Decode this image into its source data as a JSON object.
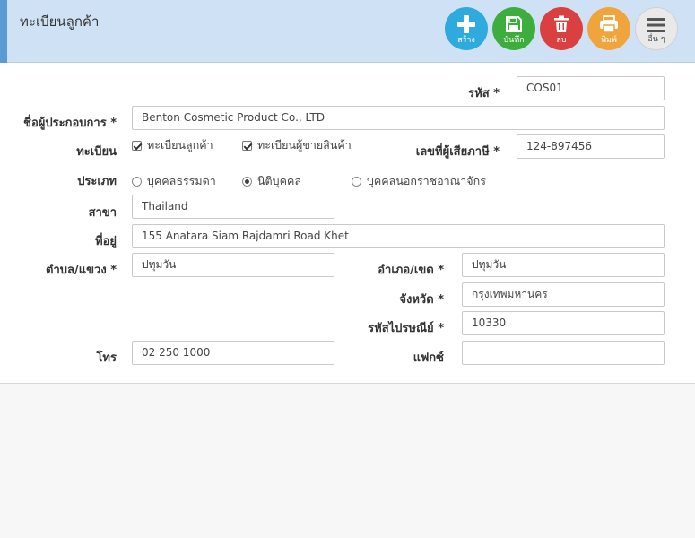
{
  "header": {
    "title": "ทะเบียนลูกค้า",
    "buttons": [
      {
        "label": "สร้าง",
        "icon": "plus-icon",
        "color": "#2eaade"
      },
      {
        "label": "บันทึก",
        "icon": "save-icon",
        "color": "#3dae3d"
      },
      {
        "label": "ลบ",
        "icon": "trash-icon",
        "color": "#da4040"
      },
      {
        "label": "พิมพ์",
        "icon": "print-icon",
        "color": "#f0a43c"
      },
      {
        "label": "อื่น ๆ",
        "icon": "menu-icon",
        "color": "#e9e9e9"
      }
    ]
  },
  "form": {
    "code": {
      "label": "รหัส *",
      "value": "COS01"
    },
    "name": {
      "label": "ชื่อผู้ประกอบการ *",
      "value": "Benton Cosmetic Product Co., LTD"
    },
    "registration": {
      "label": "ทะเบียน",
      "options": [
        {
          "label": "ทะเบียนลูกค้า",
          "checked": true
        },
        {
          "label": "ทะเบียนผู้ขายสินค้า",
          "checked": true
        }
      ]
    },
    "tax_id": {
      "label": "เลขที่ผู้เสียภาษี *",
      "value": "124-897456"
    },
    "type": {
      "label": "ประเภท",
      "options": [
        {
          "label": "บุคคลธรรมดา",
          "selected": false
        },
        {
          "label": "นิติบุคคล",
          "selected": true
        },
        {
          "label": "บุคคลนอกราชอาณาจักร",
          "selected": false
        }
      ]
    },
    "branch": {
      "label": "สาขา",
      "value": "Thailand"
    },
    "address": {
      "label": "ที่อยู่",
      "value": "155 Anatara Siam Rajdamri Road Khet"
    },
    "subdistrict": {
      "label": "ตำบล/แขวง *",
      "value": "ปทุมวัน"
    },
    "district": {
      "label": "อำเภอ/เขต *",
      "value": "ปทุมวัน"
    },
    "province": {
      "label": "จังหวัด *",
      "value": "กรุงเทพมหานคร"
    },
    "postcode": {
      "label": "รหัสไปรษณีย์ *",
      "value": "10330"
    },
    "phone": {
      "label": "โทร",
      "value": "02 250 1000"
    },
    "fax": {
      "label": "แฟกซ์",
      "value": ""
    }
  }
}
